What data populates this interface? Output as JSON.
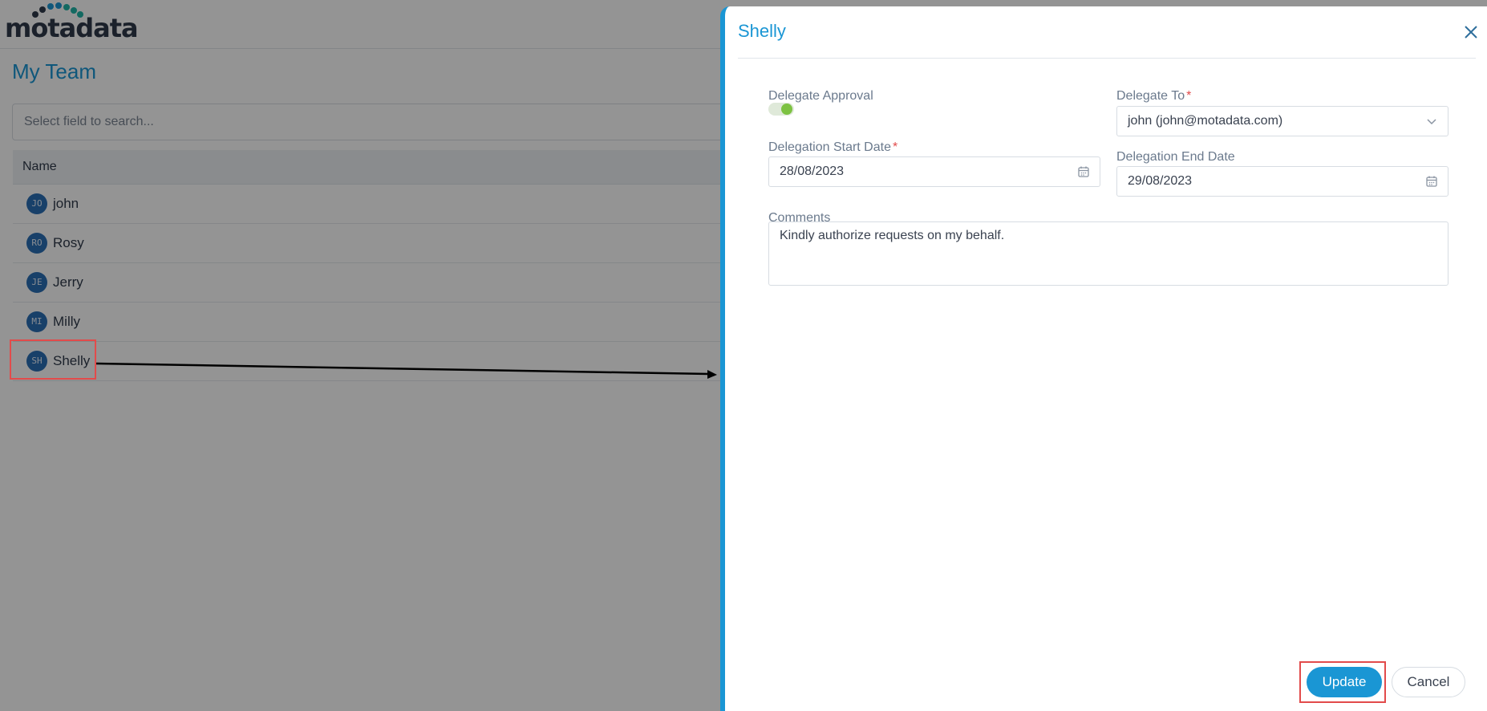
{
  "app": {
    "logo_text": "motadata"
  },
  "page": {
    "title": "My Team",
    "search_placeholder": "Select field to search..."
  },
  "table": {
    "column_name": "Name",
    "rows": [
      {
        "initials": "JO",
        "name": "john"
      },
      {
        "initials": "RO",
        "name": "Rosy"
      },
      {
        "initials": "JE",
        "name": "Jerry"
      },
      {
        "initials": "MI",
        "name": "Milly"
      },
      {
        "initials": "SH",
        "name": "Shelly"
      }
    ]
  },
  "drawer": {
    "title": "Shelly",
    "delegate_approval_label": "Delegate Approval",
    "delegate_approval_enabled": true,
    "delegate_to_label": "Delegate To",
    "delegate_to_value": "john (john@motadata.com)",
    "start_date_label": "Delegation Start Date",
    "start_date_value": "28/08/2023",
    "end_date_label": "Delegation End Date",
    "end_date_value": "29/08/2023",
    "comments_label": "Comments",
    "comments_value": "Kindly authorize requests on my behalf.",
    "required_marker": "*",
    "update_label": "Update",
    "cancel_label": "Cancel"
  },
  "colors": {
    "accent": "#1a96d4",
    "highlight": "#e24b4b",
    "toggle_on": "#7dc242",
    "avatar": "#2a6fb6"
  },
  "icons": [
    "close-icon",
    "calendar-icon",
    "chevron-down-icon"
  ]
}
